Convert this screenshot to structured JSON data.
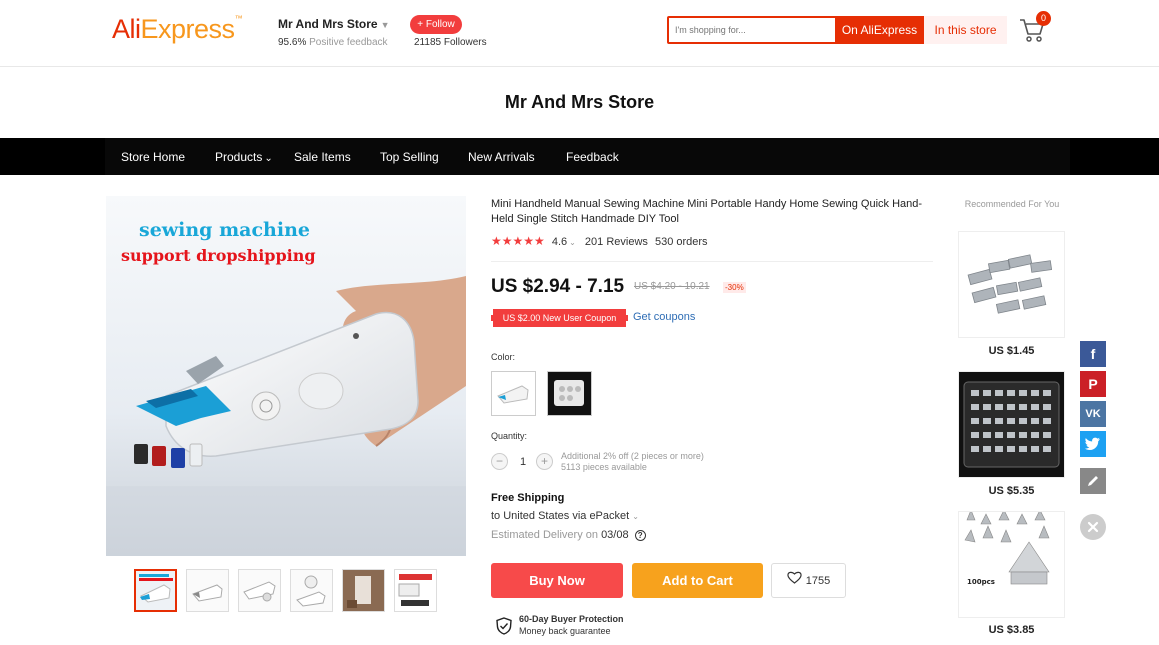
{
  "header": {
    "logo_ali": "Ali",
    "logo_express": "Express",
    "store_name": "Mr And Mrs Store",
    "feedback_pct": "95.6%",
    "feedback_label": "Positive feedback",
    "follow_label": "+ Follow",
    "followers": "21185 Followers",
    "search_placeholder": "I'm shopping for...",
    "btn_on_aliexpress": "On AliExpress",
    "btn_in_store": "In this store",
    "cart_count": "0"
  },
  "store_title": "Mr And Mrs Store",
  "nav": {
    "items": [
      "Store Home",
      "Products",
      "Sale Items",
      "Top Selling",
      "New Arrivals",
      "Feedback"
    ]
  },
  "gallery": {
    "overlay_line1": "sewing machine",
    "overlay_line2": "support dropshipping"
  },
  "product": {
    "title": "Mini Handheld Manual Sewing Machine Mini Portable Handy Home Sewing Quick Hand-Held Single Stitch Handmade DIY Tool",
    "rating": "4.6",
    "rating_stars": 4.6,
    "reviews": "201 Reviews",
    "orders": "530 orders",
    "price": "US $2.94 - 7.15",
    "old_price": "US $4.20 - 10.21",
    "discount": "-30%",
    "coupon": "US $2.00 New User Coupon",
    "get_coupons": "Get coupons",
    "color_label": "Color:",
    "quantity_label": "Quantity:",
    "quantity": "1",
    "qty_note1": "Additional 2% off (2 pieces or more)",
    "qty_note2": "5113 pieces available",
    "shipping_title": "Free Shipping",
    "shipping_dest": "to United States via ePacket",
    "delivery_label": "Estimated Delivery on",
    "delivery_date": "03/08",
    "buy_now": "Buy Now",
    "add_to_cart": "Add to Cart",
    "wishlist_count": "1755",
    "protection_title": "60-Day Buyer Protection",
    "protection_sub": "Money back guarantee"
  },
  "recommended": {
    "title": "Recommended For You",
    "items": [
      {
        "price": "US $1.45"
      },
      {
        "price": "US $5.35"
      },
      {
        "price": "US $3.85",
        "img_text": "100pcs"
      }
    ]
  },
  "colors": {
    "brand": "#e62e04",
    "buy": "#f74a4a",
    "cart": "#f7a21d",
    "facebook": "#3b5998",
    "pinterest": "#cb2027",
    "vk": "#4c75a3",
    "twitter": "#1da1f2"
  }
}
